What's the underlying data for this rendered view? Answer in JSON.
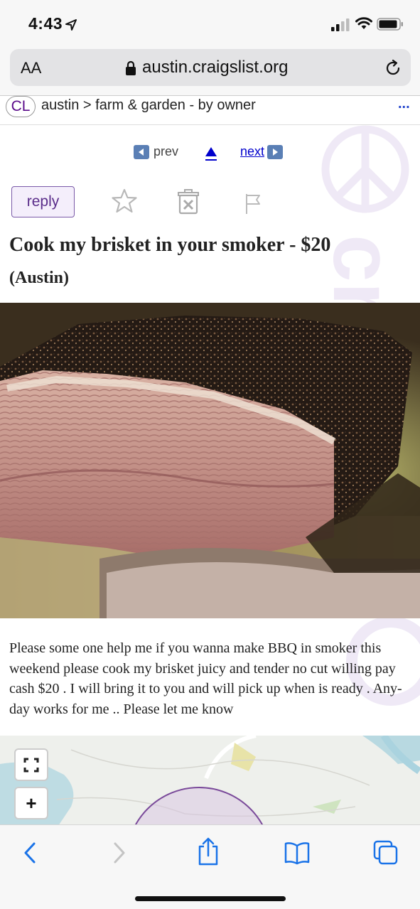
{
  "status": {
    "time": "4:43"
  },
  "browser": {
    "text_size_label": "AA",
    "url": "austin.craigslist.org"
  },
  "breadcrumb": {
    "logo": "CL",
    "path": "austin > farm & garden - by owner",
    "more": "..."
  },
  "nav": {
    "prev_label": "prev",
    "next_label": "next"
  },
  "actions": {
    "reply_label": "reply"
  },
  "posting": {
    "title": "Cook my brisket in your smoker - $20",
    "location": "(Austin)",
    "body": "Please some one help me if you wanna make BBQ in smoker this weekend please cook my brisket juicy and tender no cut willing pay cash $20 . I will bring it to you and will pick up when is ready . Any-day works for me .. Please let me know"
  },
  "map": {
    "zoom_in_label": "+"
  },
  "colors": {
    "link_blue": "#0000cc",
    "craigslist_purple": "#5a2d8a",
    "ios_blue": "#1a73e8"
  },
  "icons": {
    "status": [
      "location-arrow-icon",
      "signal-icon",
      "wifi-icon",
      "battery-icon"
    ],
    "browser": [
      "lock-icon",
      "reload-icon"
    ],
    "actions": [
      "favorite-star-icon",
      "hide-trash-icon",
      "flag-icon"
    ],
    "map": [
      "fullscreen-icon"
    ],
    "toolbar": [
      "back-icon",
      "forward-icon",
      "share-icon",
      "bookmarks-icon",
      "tabs-icon"
    ]
  }
}
